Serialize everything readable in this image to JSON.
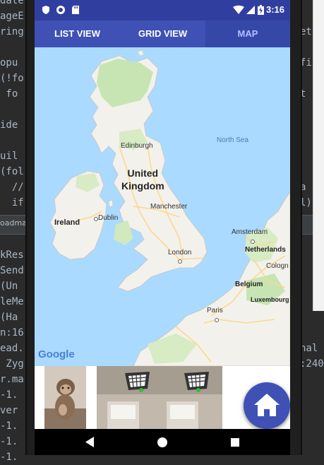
{
  "ide": {
    "left_lines": [
      "date",
      "ageE",
      "ring",
      "",
      "opu",
      "(!fo",
      " fo",
      "",
      "ide",
      "",
      "uil",
      "(fol",
      "  //",
      "  if",
      "",
      "kRes",
      "Send",
      "(Un",
      "leMe",
      "(Ha",
      "n:16",
      "ead.",
      " Zyg",
      "r.ma",
      "-1.",
      "ver",
      "-1.",
      "-1.",
      "-1."
    ],
    "right_lines": [
      "",
      "",
      "et",
      "",
      "fi",
      "",
      "t",
      "",
      "",
      "",
      "",
      "",
      "a",
      "l)",
      "",
      "",
      "",
      "",
      "",
      "",
      "",
      "nal",
      ":240"
    ],
    "bar_label": "oadma"
  },
  "status_bar": {
    "time": "3:16"
  },
  "tabs": [
    {
      "label": "LIST VIEW",
      "active": false
    },
    {
      "label": "GRID VIEW",
      "active": false
    },
    {
      "label": "MAP",
      "active": true
    }
  ],
  "map": {
    "labels": {
      "north_sea": "North Sea",
      "edinburgh": "Edinburgh",
      "uk": "United\nKingdom",
      "manchester": "Manchester",
      "ireland": "Ireland",
      "dublin": "Dublin",
      "london": "London",
      "amsterdam": "Amsterdam",
      "netherlands": "Netherlands",
      "cologne": "Cologn",
      "belgium": "Belgium",
      "luxembourg": "Luxembourg",
      "paris": "Paris"
    },
    "attribution": "Google",
    "colors": {
      "water": "#aadaff",
      "land": "#f3f1ec",
      "green": "#c7e5b2",
      "road": "#fbd98f"
    }
  },
  "gallery": {
    "items": [
      "monkey-photo",
      "ceiling-photo-1",
      "ceiling-photo-2"
    ]
  },
  "fab": {
    "icon": "home-icon",
    "color": "#3f51b5"
  },
  "navigation_bar": {
    "buttons": [
      "back-icon",
      "home-circle-icon",
      "recents-icon"
    ]
  }
}
